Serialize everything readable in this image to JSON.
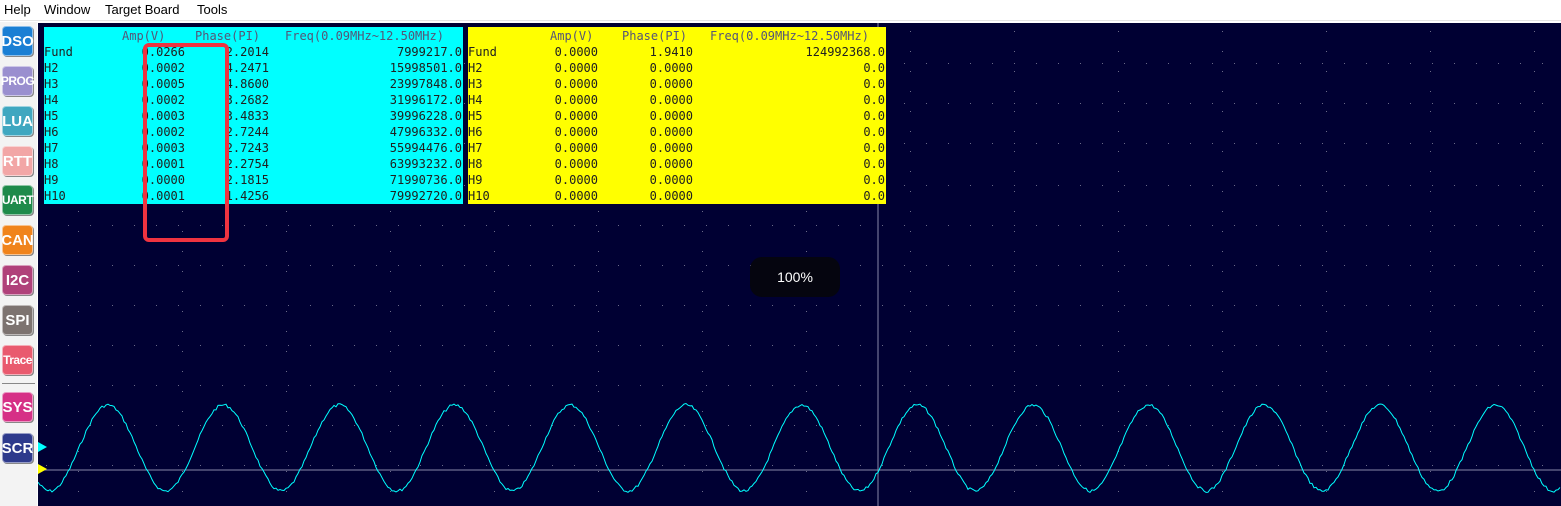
{
  "menu": {
    "items": [
      "Help",
      "Window",
      "Target Board",
      "Tools"
    ]
  },
  "sidebar": {
    "buttons": [
      {
        "label": "DSO",
        "color": "#1a7fd4"
      },
      {
        "label": "PROG",
        "color": "#9a8fcf"
      },
      {
        "label": "LUA",
        "color": "#3fa7c0"
      },
      {
        "label": "RTT",
        "color": "#f2a6a6"
      },
      {
        "label": "UART",
        "color": "#1e8a4a"
      },
      {
        "label": "CAN",
        "color": "#f0841c"
      },
      {
        "label": "I2C",
        "color": "#b0417a"
      },
      {
        "label": "SPI",
        "color": "#7d7370"
      },
      {
        "label": "Trace",
        "color": "#e95a6e"
      },
      {
        "label": "SYS",
        "color": "#d63086"
      },
      {
        "label": "SCR",
        "color": "#2e3a8c"
      }
    ]
  },
  "colors": {
    "scope_background": "#000033",
    "channel1": "#00ffff",
    "channel2": "#ffff00",
    "grid_center": "#8888aa",
    "highlight": "#ef3340"
  },
  "table_ch1": {
    "headers": {
      "amp": "Amp(V)",
      "phase": "Phase(PI)",
      "freq": "Freq(0.09MHz~12.50MHz)"
    },
    "rows": [
      {
        "name": "Fund",
        "amp": "0.0266",
        "phase": "2.2014",
        "freq": "7999217.0"
      },
      {
        "name": "H2",
        "amp": "0.0002",
        "phase": "4.2471",
        "freq": "15998501.0"
      },
      {
        "name": "H3",
        "amp": "0.0005",
        "phase": "4.8600",
        "freq": "23997848.0"
      },
      {
        "name": "H4",
        "amp": "0.0002",
        "phase": "3.2682",
        "freq": "31996172.0"
      },
      {
        "name": "H5",
        "amp": "0.0003",
        "phase": "3.4833",
        "freq": "39996228.0"
      },
      {
        "name": "H6",
        "amp": "0.0002",
        "phase": "2.7244",
        "freq": "47996332.0"
      },
      {
        "name": "H7",
        "amp": "0.0003",
        "phase": "2.7243",
        "freq": "55994476.0"
      },
      {
        "name": "H8",
        "amp": "0.0001",
        "phase": "2.2754",
        "freq": "63993232.0"
      },
      {
        "name": "H9",
        "amp": "0.0000",
        "phase": "2.1815",
        "freq": "71990736.0"
      },
      {
        "name": "H10",
        "amp": "0.0001",
        "phase": "1.4256",
        "freq": "79992720.0"
      }
    ]
  },
  "table_ch2": {
    "headers": {
      "amp": "Amp(V)",
      "phase": "Phase(PI)",
      "freq": "Freq(0.09MHz~12.50MHz)"
    },
    "rows": [
      {
        "name": "Fund",
        "amp": "0.0000",
        "phase": "1.9410",
        "freq": "124992368.0"
      },
      {
        "name": "H2",
        "amp": "0.0000",
        "phase": "0.0000",
        "freq": "0.0"
      },
      {
        "name": "H3",
        "amp": "0.0000",
        "phase": "0.0000",
        "freq": "0.0"
      },
      {
        "name": "H4",
        "amp": "0.0000",
        "phase": "0.0000",
        "freq": "0.0"
      },
      {
        "name": "H5",
        "amp": "0.0000",
        "phase": "0.0000",
        "freq": "0.0"
      },
      {
        "name": "H6",
        "amp": "0.0000",
        "phase": "0.0000",
        "freq": "0.0"
      },
      {
        "name": "H7",
        "amp": "0.0000",
        "phase": "0.0000",
        "freq": "0.0"
      },
      {
        "name": "H8",
        "amp": "0.0000",
        "phase": "0.0000",
        "freq": "0.0"
      },
      {
        "name": "H9",
        "amp": "0.0000",
        "phase": "0.0000",
        "freq": "0.0"
      },
      {
        "name": "H10",
        "amp": "0.0000",
        "phase": "0.0000",
        "freq": "0.0"
      }
    ]
  },
  "zoom": {
    "label": "100%"
  },
  "waveform": {
    "cycles": 13.1
  }
}
